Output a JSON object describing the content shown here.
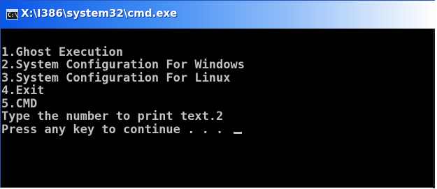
{
  "window": {
    "title": "X:\\I386\\system32\\cmd.exe",
    "icon": "cmd-icon",
    "icon_glyph": "C:\\"
  },
  "console": {
    "lines": [
      "",
      "1.Ghost Execution",
      "2.System Configuration For Windows",
      "3.System Configuration For Linux",
      "4.Exit",
      "5.CMD",
      "Type the number to print text.2",
      "Press any key to continue . . . "
    ]
  },
  "colors": {
    "console_background": "#000000",
    "console_text": "#c0c0c0",
    "titlebar_start": "#0a56e6",
    "titlebar_end": "#ffffff"
  }
}
